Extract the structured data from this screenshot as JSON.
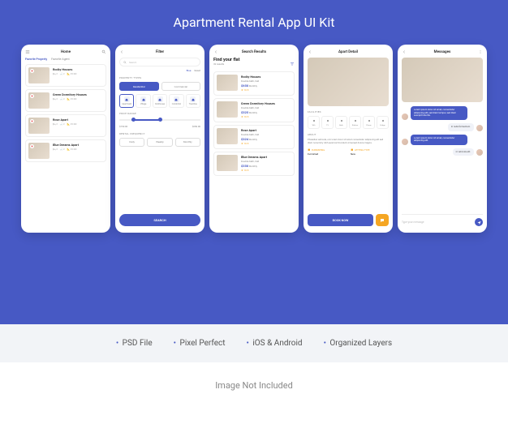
{
  "title": "Apartment Rental App UI Kit",
  "features": [
    "PSD File",
    "Pixel Perfect",
    "iOS & Android",
    "Organized Layers"
  ],
  "footer_note": "Image Not Included",
  "screens": {
    "home": {
      "title": "Home",
      "tabs": [
        "Favorite Property",
        "Favorite Agent"
      ],
      "listings": [
        {
          "name": "Rocky Houses",
          "features": [
            "3",
            "2",
            "45 M2"
          ]
        },
        {
          "name": "Green Dormitory Houses",
          "features": [
            "3",
            "2",
            "45 M2"
          ]
        },
        {
          "name": "Rose Apart",
          "features": [
            "3",
            "2",
            "45 M2"
          ]
        },
        {
          "name": "Blue Dreams Apart",
          "features": [
            "3",
            "2",
            "45 M2"
          ]
        }
      ]
    },
    "filter": {
      "title": "Filter",
      "search_placeholder": "Search",
      "actions": {
        "blue": "Blue",
        "reset": "Reset"
      },
      "property_types_label": "PROPERTY TYPES",
      "property_types": [
        "Residential",
        "Commercial"
      ],
      "subtypes": [
        "Apartment",
        "Village",
        "Penthouse",
        "Condomin",
        "Townhou"
      ],
      "price_label": "PRICE RANGE",
      "price_min": "$150.00",
      "price_max": "$250.00",
      "frequency_label": "RENTAL FREQUENCY",
      "frequencies": [
        "Daily",
        "Weekly",
        "Monthly"
      ],
      "search_btn": "SEARCH"
    },
    "results": {
      "title": "Search Results",
      "big_title": "Find your flat",
      "count": "32 results",
      "items": [
        {
          "name": "Rocky Houses",
          "sub": "Double bath, hall",
          "price": "$650",
          "unit": "Monthly",
          "stars": "★ 10.5"
        },
        {
          "name": "Green Dormitory Houses",
          "sub": "Double bath, hall",
          "price": "$525",
          "unit": "Monthly",
          "stars": "★ 10.5"
        },
        {
          "name": "Rose Apart",
          "sub": "Double bath, hall",
          "price": "$324",
          "unit": "Monthly",
          "stars": "★ 10.5"
        },
        {
          "name": "Blue Dreams Apart",
          "sub": "Double bath, hall",
          "price": "$550",
          "unit": "Monthly",
          "stars": "★ 10.5"
        }
      ]
    },
    "detail": {
      "title": "Apart Detail",
      "facilities_label": "FACILITIES",
      "facilities": [
        {
          "icon": "wifi",
          "label": "Wifi"
        },
        {
          "icon": "tv",
          "label": "TV"
        },
        {
          "icon": "bath",
          "label": "Bath"
        },
        {
          "icon": "kitchen",
          "label": "Kitchen"
        },
        {
          "icon": "phone",
          "label": "Phone"
        },
        {
          "icon": "fridge",
          "label": "Fridge"
        }
      ],
      "about_label": "ABOUT",
      "about": "Phasellus vehicula, orci lorem dolor sit amet consectetur adipiscing elit sed diam nonummy nibh euismod tincidunt ut laoreet dolore magna.",
      "specs": [
        {
          "k": "FURNISHING",
          "v": "Furnished"
        },
        {
          "k": "LETTING TYPE",
          "v": "New"
        }
      ],
      "book_btn": "BOOK NOW"
    },
    "messages": {
      "title": "Messages",
      "msgs": [
        {
          "dir": "sent",
          "text": "Lorem ipsum dolor sit amet, consectetur adipiscing elit, sed diam tempor, sed diam suscipit lobortis."
        },
        {
          "dir": "recv",
          "text": "In nulla fermentum."
        },
        {
          "dir": "sent",
          "text": "Lorem ipsum dolor sit amet, consectetur adipiscing elit."
        },
        {
          "dir": "recv",
          "text": "in vehicula elit."
        }
      ],
      "input_placeholder": "Type your message"
    }
  }
}
